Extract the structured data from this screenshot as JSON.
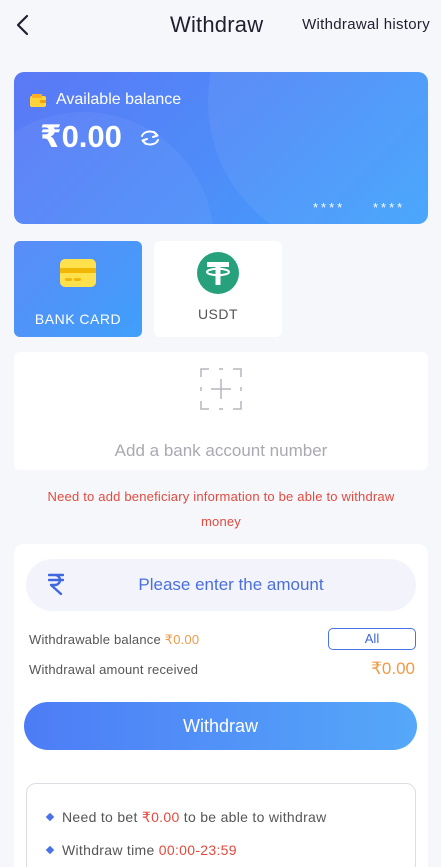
{
  "header": {
    "title": "Withdraw",
    "history_link": "Withdrawal history"
  },
  "balance_card": {
    "label": "Available balance",
    "amount": "₹0.00",
    "masked_1": "****",
    "masked_2": "****"
  },
  "methods": [
    {
      "label": "BANK CARD",
      "icon": "bank-card-icon",
      "selected": true
    },
    {
      "label": "USDT",
      "icon": "tether-icon",
      "selected": false
    }
  ],
  "add_bank": {
    "label": "Add a bank account number"
  },
  "warning": {
    "line_1": "Need to add beneficiary information to be able to withdraw",
    "line_2": "money"
  },
  "form": {
    "amount_placeholder": "Please enter the amount",
    "withdrawable_label": "Withdrawable balance",
    "withdrawable_value": "₹0.00",
    "all_button": "All",
    "received_label": "Withdrawal amount received",
    "received_value": "₹0.00",
    "submit_label": "Withdraw"
  },
  "rules": {
    "rule_1_prefix": "Need to bet",
    "rule_1_value": "₹0.00",
    "rule_1_suffix": "to be able to withdraw",
    "rule_2_prefix": "Withdraw time",
    "rule_2_value": "00:00-23:59"
  },
  "colors": {
    "accent": "#4a72e8",
    "warning": "#e34a3e",
    "highlight": "#f19a45"
  }
}
